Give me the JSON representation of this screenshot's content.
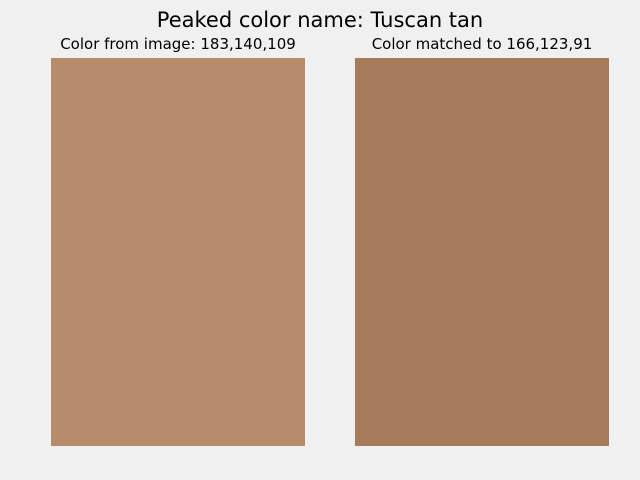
{
  "title": "Peaked color name: Tuscan tan",
  "panels": [
    {
      "label": "Color from image: 183,140,109",
      "color": "#b78c6d"
    },
    {
      "label": "Color matched to 166,123,91",
      "color": "#a67b5b"
    }
  ],
  "background_color": "#f0f0f0"
}
